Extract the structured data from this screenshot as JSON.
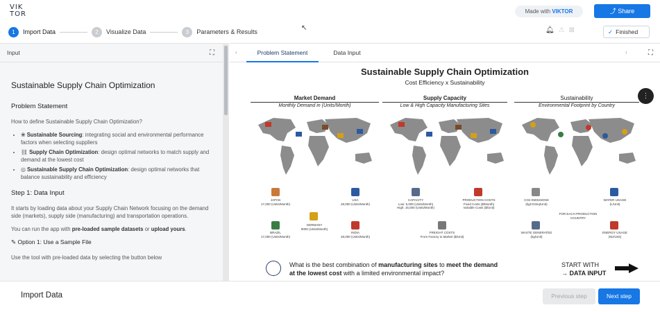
{
  "header": {
    "logo_line1": "VIK",
    "logo_line2": "TOR",
    "made_with_prefix": "Made with",
    "made_with_brand": "VIKTOR",
    "share_label": "Share",
    "finished_label": "Finished"
  },
  "steps": [
    {
      "num": "1",
      "label": "Import Data"
    },
    {
      "num": "2",
      "label": "Visualize Data"
    },
    {
      "num": "3",
      "label": "Parameters & Results"
    }
  ],
  "left_panel": {
    "header": "Input",
    "title": "Sustainable Supply Chain Optimization",
    "section1": "Problem Statement",
    "question": "How to define Sustainable Supply Chain Optimization?",
    "bullets": [
      {
        "bold": "Sustainable Sourcing",
        "text": ": integrating social and environmental performance factors when selecting suppliers"
      },
      {
        "bold": "Supply Chain Optimization",
        "text": ": design optimal networks to match supply and demand at the lowest cost"
      },
      {
        "bold": "Sustainable Supply Chain Optimization",
        "text": ": design optimal networks that balance sustainability and efficiency"
      }
    ],
    "section2": "Step 1: Data Input",
    "para1": "It starts by loading data about your Supply Chain Network focusing on the demand side (markets), supply side (manufacturing) and transportation operations.",
    "para2_prefix": "You can run the app with ",
    "para2_b1": "pre-loaded sample datasets",
    "para2_mid": " or ",
    "para2_b2": "upload yours",
    "para2_suffix": ".",
    "option1": "Option 1: Use a Sample File",
    "option1_text": "Use the tool with pre-loaded data by selecting the button below"
  },
  "right_panel": {
    "tabs": [
      "Problem Statement",
      "Data Input"
    ],
    "figure": {
      "title": "Sustainable Supply Chain Optimization",
      "subtitle": "Cost Efficiency x Sustainability",
      "columns": [
        {
          "head": "Market Demand",
          "sub": "Monthly Demand in (Units/Month)"
        },
        {
          "head": "Supply Capacity",
          "sub": "Low & High Capacity Manufacturing Sites"
        },
        {
          "head": "Sustainability",
          "sub": "Environmental Footprint by Country"
        }
      ],
      "demand_labels": [
        {
          "name": "JAPAN",
          "value": "17,000 (Units/Month)"
        },
        {
          "name": "USA",
          "value": "28,000 (Units/Month)"
        },
        {
          "name": "GERMANY",
          "value": "9000 (Units/Month)"
        },
        {
          "name": "BRAZIL",
          "value": "17,000 (Units/Month)"
        },
        {
          "name": "INDIA",
          "value": "28,000 (Units/Month)"
        }
      ],
      "capacity_labels": {
        "capacity_title": "CAPACITY",
        "capacity_low": "Low: 5,000 (Units/Month)",
        "capacity_high": "High: 15,000 (Units/Month)",
        "prod_title": "PRODUCTION COSTS",
        "prod_fixed": "Fixed Costs ($/Month)",
        "prod_var": "Variable Costs ($/Unit)",
        "freight_title": "FREIGHT COSTS",
        "freight_text": "From Factory to Market ($/Unit)"
      },
      "sustain_labels": {
        "co2": "CO2 EMISSIONS",
        "co2_unit": "(kgCO2eq/Unit)",
        "water": "WATER USAGE",
        "water_unit": "(L/Unit)",
        "center": "FOR EACH PRODUCTION COUNTRY",
        "waste": "WASTE GENERATED",
        "waste_unit": "(kg/Unit)",
        "energy": "ENERGY USAGE",
        "energy_unit": "(MJ/Unit)"
      },
      "question_prefix": "What is the best combination of ",
      "question_bold1": "manufacturing sites",
      "question_mid": " to ",
      "question_bold2": "meet the demand",
      "question_line2_bold": "at the lowest cost",
      "question_line2": " with a limited environmental impact?",
      "cta_line1": "START WITH",
      "cta_line2": "→ DATA INPUT"
    }
  },
  "footer": {
    "title": "Import Data",
    "prev_label": "Previous step",
    "next_label": "Next step"
  },
  "colors": {
    "accent": "#1677e5",
    "map": "#8c8c8c"
  }
}
